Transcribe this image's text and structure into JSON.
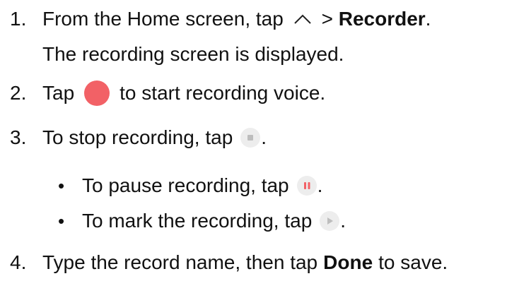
{
  "steps": [
    {
      "num": "1.",
      "pre": "From the Home screen, tap",
      "sep": " > ",
      "bold": "Recorder",
      "post": ".",
      "note": "The recording screen is displayed."
    },
    {
      "num": "2.",
      "pre": "Tap",
      "post": "to start recording voice."
    },
    {
      "num": "3.",
      "pre": "To stop recording, tap",
      "post": "."
    },
    {
      "num": "4.",
      "pre": "Type the record name, then tap",
      "bold": "Done",
      "post": "to save."
    }
  ],
  "sub": [
    {
      "bullet": "•",
      "pre": "To pause recording, tap",
      "post": "."
    },
    {
      "bullet": "•",
      "pre": "To mark the recording, tap",
      "post": "."
    }
  ],
  "icons": {
    "chevron": "chevron-up-icon",
    "record": "record-icon",
    "stop": "stop-icon",
    "pause": "pause-icon",
    "mark": "play-icon"
  },
  "colors": {
    "record": "#F26166",
    "icon_bg": "#EDEDED",
    "icon_fg": "#BDBDBD"
  }
}
